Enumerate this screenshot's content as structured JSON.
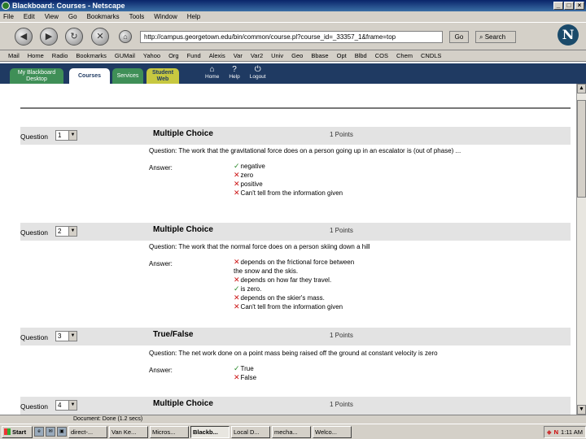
{
  "window": {
    "title": "Blackboard: Courses - Netscape",
    "buttons": [
      "_",
      "□",
      "×"
    ]
  },
  "menu": [
    "File",
    "Edit",
    "View",
    "Go",
    "Bookmarks",
    "Tools",
    "Window",
    "Help"
  ],
  "navbar": {
    "url": "http://campus.georgetown.edu/bin/common/course.pl?course_id=_33357_1&frame=top",
    "go_label": "Go",
    "search_label": "Search",
    "nav_glyphs": [
      "◀",
      "▶",
      "↻",
      "✕",
      "⌂"
    ]
  },
  "personal_toolbar": [
    "Mail",
    "Home",
    "Radio",
    "Bookmarks",
    "GUMail",
    "Yahoo",
    "Org",
    "Fund",
    "Alexis",
    "Var",
    "Var2",
    "Univ",
    "Geo",
    "Bbase",
    "Opt",
    "Blbd",
    "COS",
    "Chem",
    "CNDLS"
  ],
  "bb_tabs": {
    "my_bb": "My Blackboard Desktop",
    "courses": "Courses",
    "services": "Services",
    "student_web": "Student Web"
  },
  "bb_icons": [
    {
      "glyph": "⌂",
      "label": "Home"
    },
    {
      "glyph": "?",
      "label": "Help"
    },
    {
      "glyph": "⏻",
      "label": "Logout"
    }
  ],
  "labels": {
    "question": "Question",
    "answer": "Answer:"
  },
  "questions": [
    {
      "number": "1",
      "type": "Multiple Choice",
      "points": "1 Points",
      "text": "Question: The work that the gravitational force does on a person going up in an escalator is (out of phase) ...",
      "options": [
        {
          "mark": "ok",
          "text": "negative"
        },
        {
          "mark": "bad",
          "text": "zero"
        },
        {
          "mark": "bad",
          "text": "positive"
        },
        {
          "mark": "bad",
          "text": "Can't tell from the information given"
        }
      ]
    },
    {
      "number": "2",
      "type": "Multiple Choice",
      "points": "1 Points",
      "text": "Question: The work that the normal force does on a person skiing down a hill",
      "options": [
        {
          "mark": "bad",
          "text": "depends on the frictional force between the snow and the skis."
        },
        {
          "mark": "bad",
          "text": "depends on how far they travel."
        },
        {
          "mark": "ok",
          "text": "is zero."
        },
        {
          "mark": "bad",
          "text": "depends on the skier's mass."
        },
        {
          "mark": "bad",
          "text": "Can't tell from the information given"
        }
      ]
    },
    {
      "number": "3",
      "type": "True/False",
      "points": "1 Points",
      "text": "Question: The net work done on a point mass being raised off the ground at constant velocity is zero",
      "options": [
        {
          "mark": "ok",
          "text": "True"
        },
        {
          "mark": "bad",
          "text": "False"
        }
      ]
    },
    {
      "number": "4",
      "type": "Multiple Choice",
      "points": "1 Points"
    }
  ],
  "status_text": "Document: Done (1.2 secs)",
  "taskbar": {
    "start": "Start",
    "tasks": [
      "direct-...",
      "Van Ke...",
      "Micros...",
      "Blackb...",
      "Local D...",
      "mecha...",
      "Welco..."
    ],
    "active_index": 3,
    "clock": "1:11 AM"
  }
}
